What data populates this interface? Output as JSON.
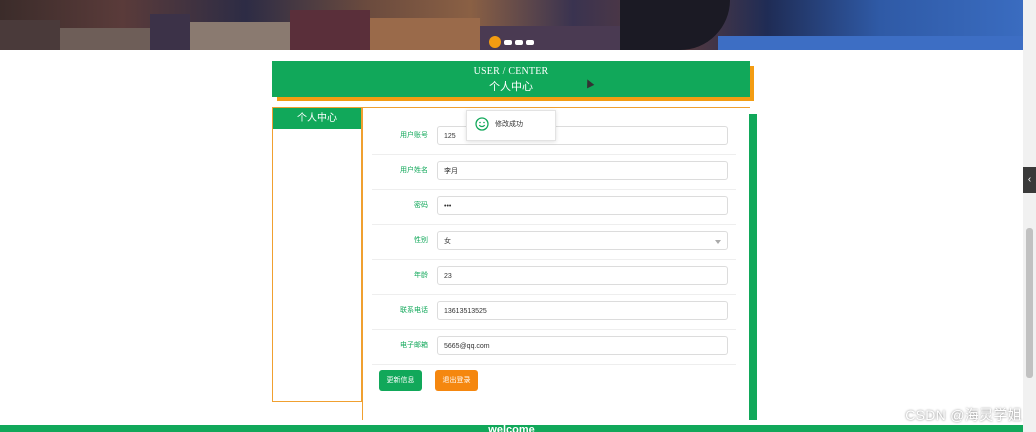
{
  "banner": {
    "active_slide": 1,
    "slide_count": 4
  },
  "header": {
    "title_en": "USER / CENTER",
    "title_cn": "个人中心"
  },
  "sidebar": {
    "items": [
      {
        "label": "个人中心"
      }
    ]
  },
  "form": {
    "fields": [
      {
        "label": "用户账号",
        "value": "125"
      },
      {
        "label": "用户姓名",
        "value": "李月"
      },
      {
        "label": "密码",
        "value": "•••"
      },
      {
        "label": "性别",
        "value": "女"
      },
      {
        "label": "年龄",
        "value": "23"
      },
      {
        "label": "联系电话",
        "value": "13613513525"
      },
      {
        "label": "电子邮箱",
        "value": "5665@qq.com"
      }
    ],
    "update_label": "更新信息",
    "logout_label": "退出登录"
  },
  "toast": {
    "message": "修改成功"
  },
  "footer": {
    "text": "welcome"
  },
  "side_tab": {
    "icon": "chevron-left-icon",
    "glyph": "‹"
  },
  "watermark": "CSDN @海灵学姐",
  "colors": {
    "primary": "#11a85a",
    "accent": "#f39c12",
    "logout": "#f5870f"
  }
}
